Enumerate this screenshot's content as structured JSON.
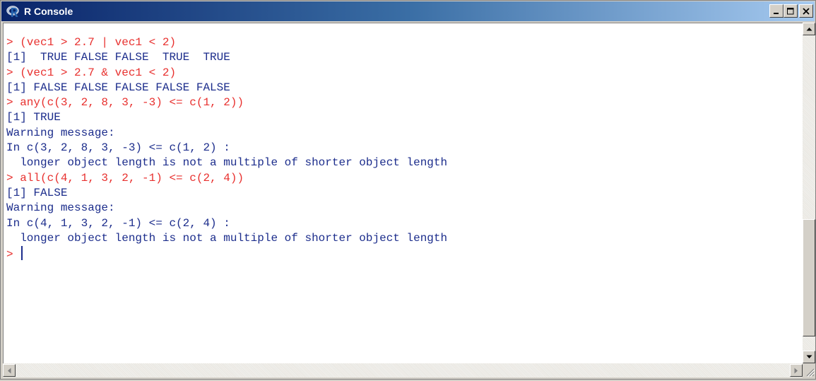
{
  "window": {
    "title": "R Console"
  },
  "icons": {
    "app": "r-logo-icon",
    "minimize": "minimize-icon",
    "maximize": "maximize-icon",
    "close": "close-icon",
    "scroll_up": "chevron-up-icon",
    "scroll_down": "chevron-down-icon",
    "scroll_left": "chevron-left-icon",
    "scroll_right": "chevron-right-icon",
    "resize_grip": "resize-grip-icon"
  },
  "colors": {
    "command_text": "#e8312f",
    "output_text": "#1c2d8c",
    "titlebar_start": "#0a246a",
    "titlebar_end": "#a6caf0"
  },
  "console": {
    "lines": [
      {
        "type": "cmd",
        "text": "> (vec1 > 2.7 | vec1 < 2)"
      },
      {
        "type": "out",
        "text": "[1]  TRUE FALSE FALSE  TRUE  TRUE"
      },
      {
        "type": "cmd",
        "text": "> (vec1 > 2.7 & vec1 < 2)"
      },
      {
        "type": "out",
        "text": "[1] FALSE FALSE FALSE FALSE FALSE"
      },
      {
        "type": "cmd",
        "text": "> any(c(3, 2, 8, 3, -3) <= c(1, 2))"
      },
      {
        "type": "out",
        "text": "[1] TRUE"
      },
      {
        "type": "out",
        "text": "Warning message:"
      },
      {
        "type": "out",
        "text": "In c(3, 2, 8, 3, -3) <= c(1, 2) :"
      },
      {
        "type": "out",
        "text": "  longer object length is not a multiple of shorter object length"
      },
      {
        "type": "cmd",
        "text": "> all(c(4, 1, 3, 2, -1) <= c(2, 4))"
      },
      {
        "type": "out",
        "text": "[1] FALSE"
      },
      {
        "type": "out",
        "text": "Warning message:"
      },
      {
        "type": "out",
        "text": "In c(4, 1, 3, 2, -1) <= c(2, 4) :"
      },
      {
        "type": "out",
        "text": "  longer object length is not a multiple of shorter object length"
      }
    ],
    "prompt": "> "
  }
}
